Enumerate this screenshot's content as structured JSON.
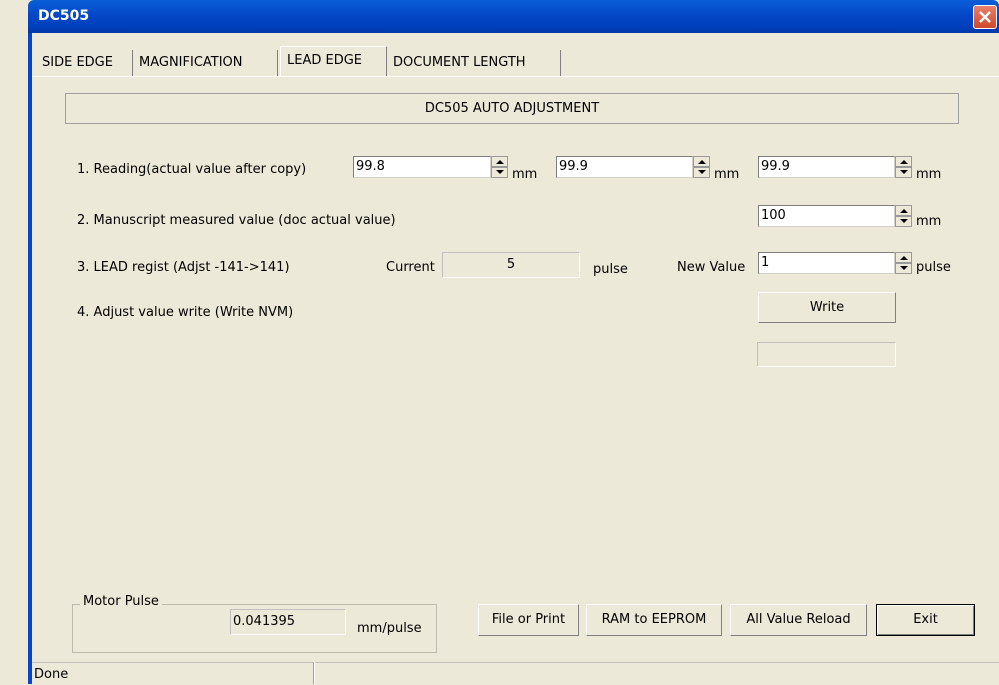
{
  "window": {
    "title": "DC505"
  },
  "tabs": [
    {
      "label": "SIDE EDGE"
    },
    {
      "label": "MAGNIFICATION"
    },
    {
      "label": "LEAD EDGE"
    },
    {
      "label": "DOCUMENT LENGTH"
    }
  ],
  "header": {
    "title": "DC505 AUTO ADJUSTMENT"
  },
  "rows": {
    "reading": {
      "label": "1. Reading(actual value after copy)",
      "value1": "99.8",
      "value2": "99.9",
      "value3": "99.9",
      "unit": "mm"
    },
    "manuscript": {
      "label": "2. Manuscript measured value (doc actual value)",
      "value": "100",
      "unit": "mm"
    },
    "lead": {
      "label": "3. LEAD regist (Adjst -141->141)",
      "current_label": "Current",
      "current_value": "5",
      "pulse_unit": "pulse",
      "new_value_label": "New Value",
      "new_value": "1"
    },
    "write": {
      "label": "4. Adjust value write (Write NVM)",
      "button": "Write",
      "status": ""
    }
  },
  "motor": {
    "group_label": "Motor Pulse",
    "value": "0.041395",
    "unit": "mm/pulse"
  },
  "buttons": {
    "file_print": "File or Print",
    "ram_eeprom": "RAM to EEPROM",
    "reload": "All Value Reload",
    "exit": "Exit"
  },
  "statusbar": {
    "text": "Done"
  }
}
